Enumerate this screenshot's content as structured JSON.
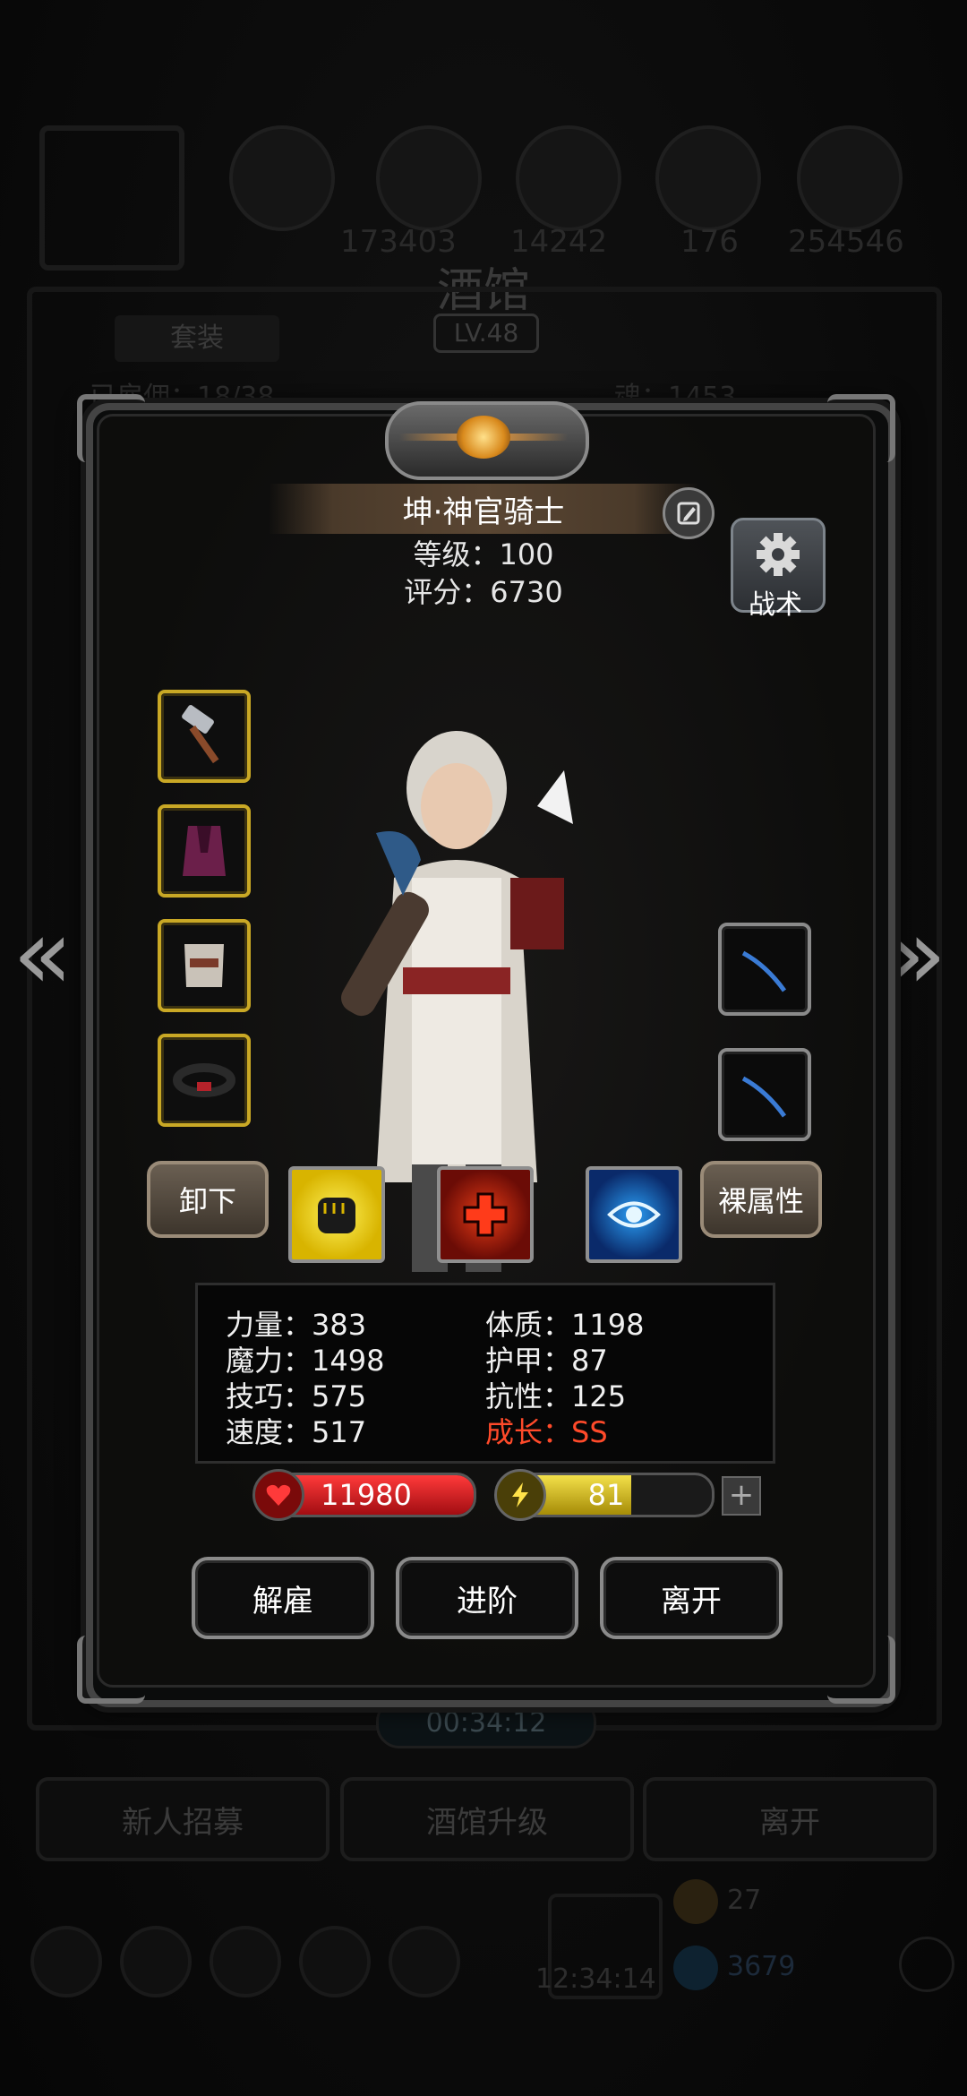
{
  "background": {
    "resource_values": [
      "173403",
      "14242",
      "176",
      "254546"
    ],
    "title": "酒馆",
    "level": "LV.48",
    "tab": "套装",
    "bg_count_label": "已雇佣：18/38",
    "bg_soul_label": "魂：1453",
    "timer": "00:34:12",
    "buttons": [
      "新人招募",
      "酒馆升级",
      "离开"
    ],
    "clock": "12:34:14",
    "currency_1": "27",
    "currency_2": "3679"
  },
  "hero": {
    "name": "坤·神官骑士",
    "level_label": "等级：100",
    "score_label": "评分：6730",
    "tactics_label": "战术"
  },
  "equipment": {
    "left_slots": [
      "hammer-icon",
      "cloak-icon",
      "armor-icon",
      "belt-icon"
    ],
    "right_slots": [
      "curved-blade-icon",
      "curved-blade-icon"
    ]
  },
  "buttons": {
    "unequip": "卸下",
    "base_attributes": "裸属性",
    "dismiss": "解雇",
    "advance": "进阶",
    "leave": "离开"
  },
  "skills": [
    "fist-icon",
    "red-cross-icon",
    "eye-icon"
  ],
  "stats": {
    "left": [
      "力量：383",
      "魔力：1498",
      "技巧：575",
      "速度：517"
    ],
    "right": [
      "体质：1198",
      "护甲：87",
      "抗性：125",
      "成长：SS"
    ]
  },
  "bars": {
    "hp": "11980",
    "energy": "81",
    "energy_fraction": 0.62
  },
  "colors": {
    "gold_border": "#c9a825",
    "growth_text": "#ff4a2a",
    "hp_bar": "#c8141c",
    "energy_bar": "#d8c21a"
  }
}
